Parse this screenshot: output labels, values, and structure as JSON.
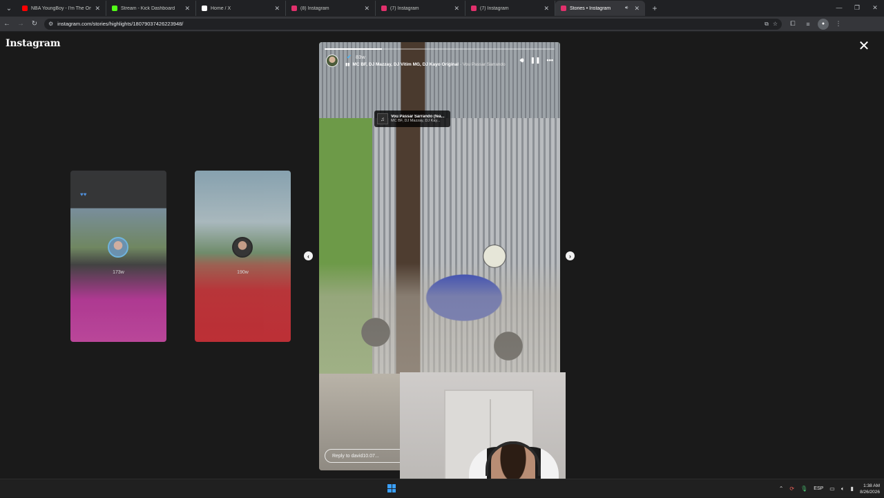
{
  "browser": {
    "tabs": [
      {
        "title": "NBA YoungBoy - I'm The One",
        "favicon": "youtube-icon",
        "color": "#ff0000",
        "active": false
      },
      {
        "title": "Stream - Kick Dashboard",
        "favicon": "kick-icon",
        "color": "#53fc18",
        "active": false
      },
      {
        "title": "Home / X",
        "favicon": "x-icon",
        "color": "#ffffff",
        "active": false
      },
      {
        "title": "(8) Instagram",
        "favicon": "instagram-icon",
        "color": "#e1306c",
        "active": false
      },
      {
        "title": "(7) Instagram",
        "favicon": "instagram-icon",
        "color": "#e1306c",
        "active": false
      },
      {
        "title": "(7) Instagram",
        "favicon": "instagram-icon",
        "color": "#e1306c",
        "active": false
      },
      {
        "title": "Stories • Instagram",
        "favicon": "instagram-icon",
        "color": "#e1306c",
        "active": true
      }
    ],
    "url": "instagram.com/stories/highlights/18079037426223948/"
  },
  "instagram": {
    "logo": "Instagram",
    "previews": [
      {
        "ago": "173w"
      },
      {
        "ago": "190w"
      }
    ],
    "story": {
      "time_ago": "83w",
      "artists": "MC BF, DJ Mazzay, DJ Vitim MG, DJ Kayo Original",
      "song_separator": "·",
      "song": "Vou Passar Sarrando",
      "sticker_title": "Vou Passar Sarrando (fea...",
      "sticker_artists": "MC BF, DJ Mazzay, DJ Kay...",
      "progress": 0.25,
      "reply_placeholder": "Reply to david10.07..."
    }
  },
  "taskbar": {
    "language": "ESP",
    "time": "1:38 AM",
    "date": "8/26/2026"
  }
}
